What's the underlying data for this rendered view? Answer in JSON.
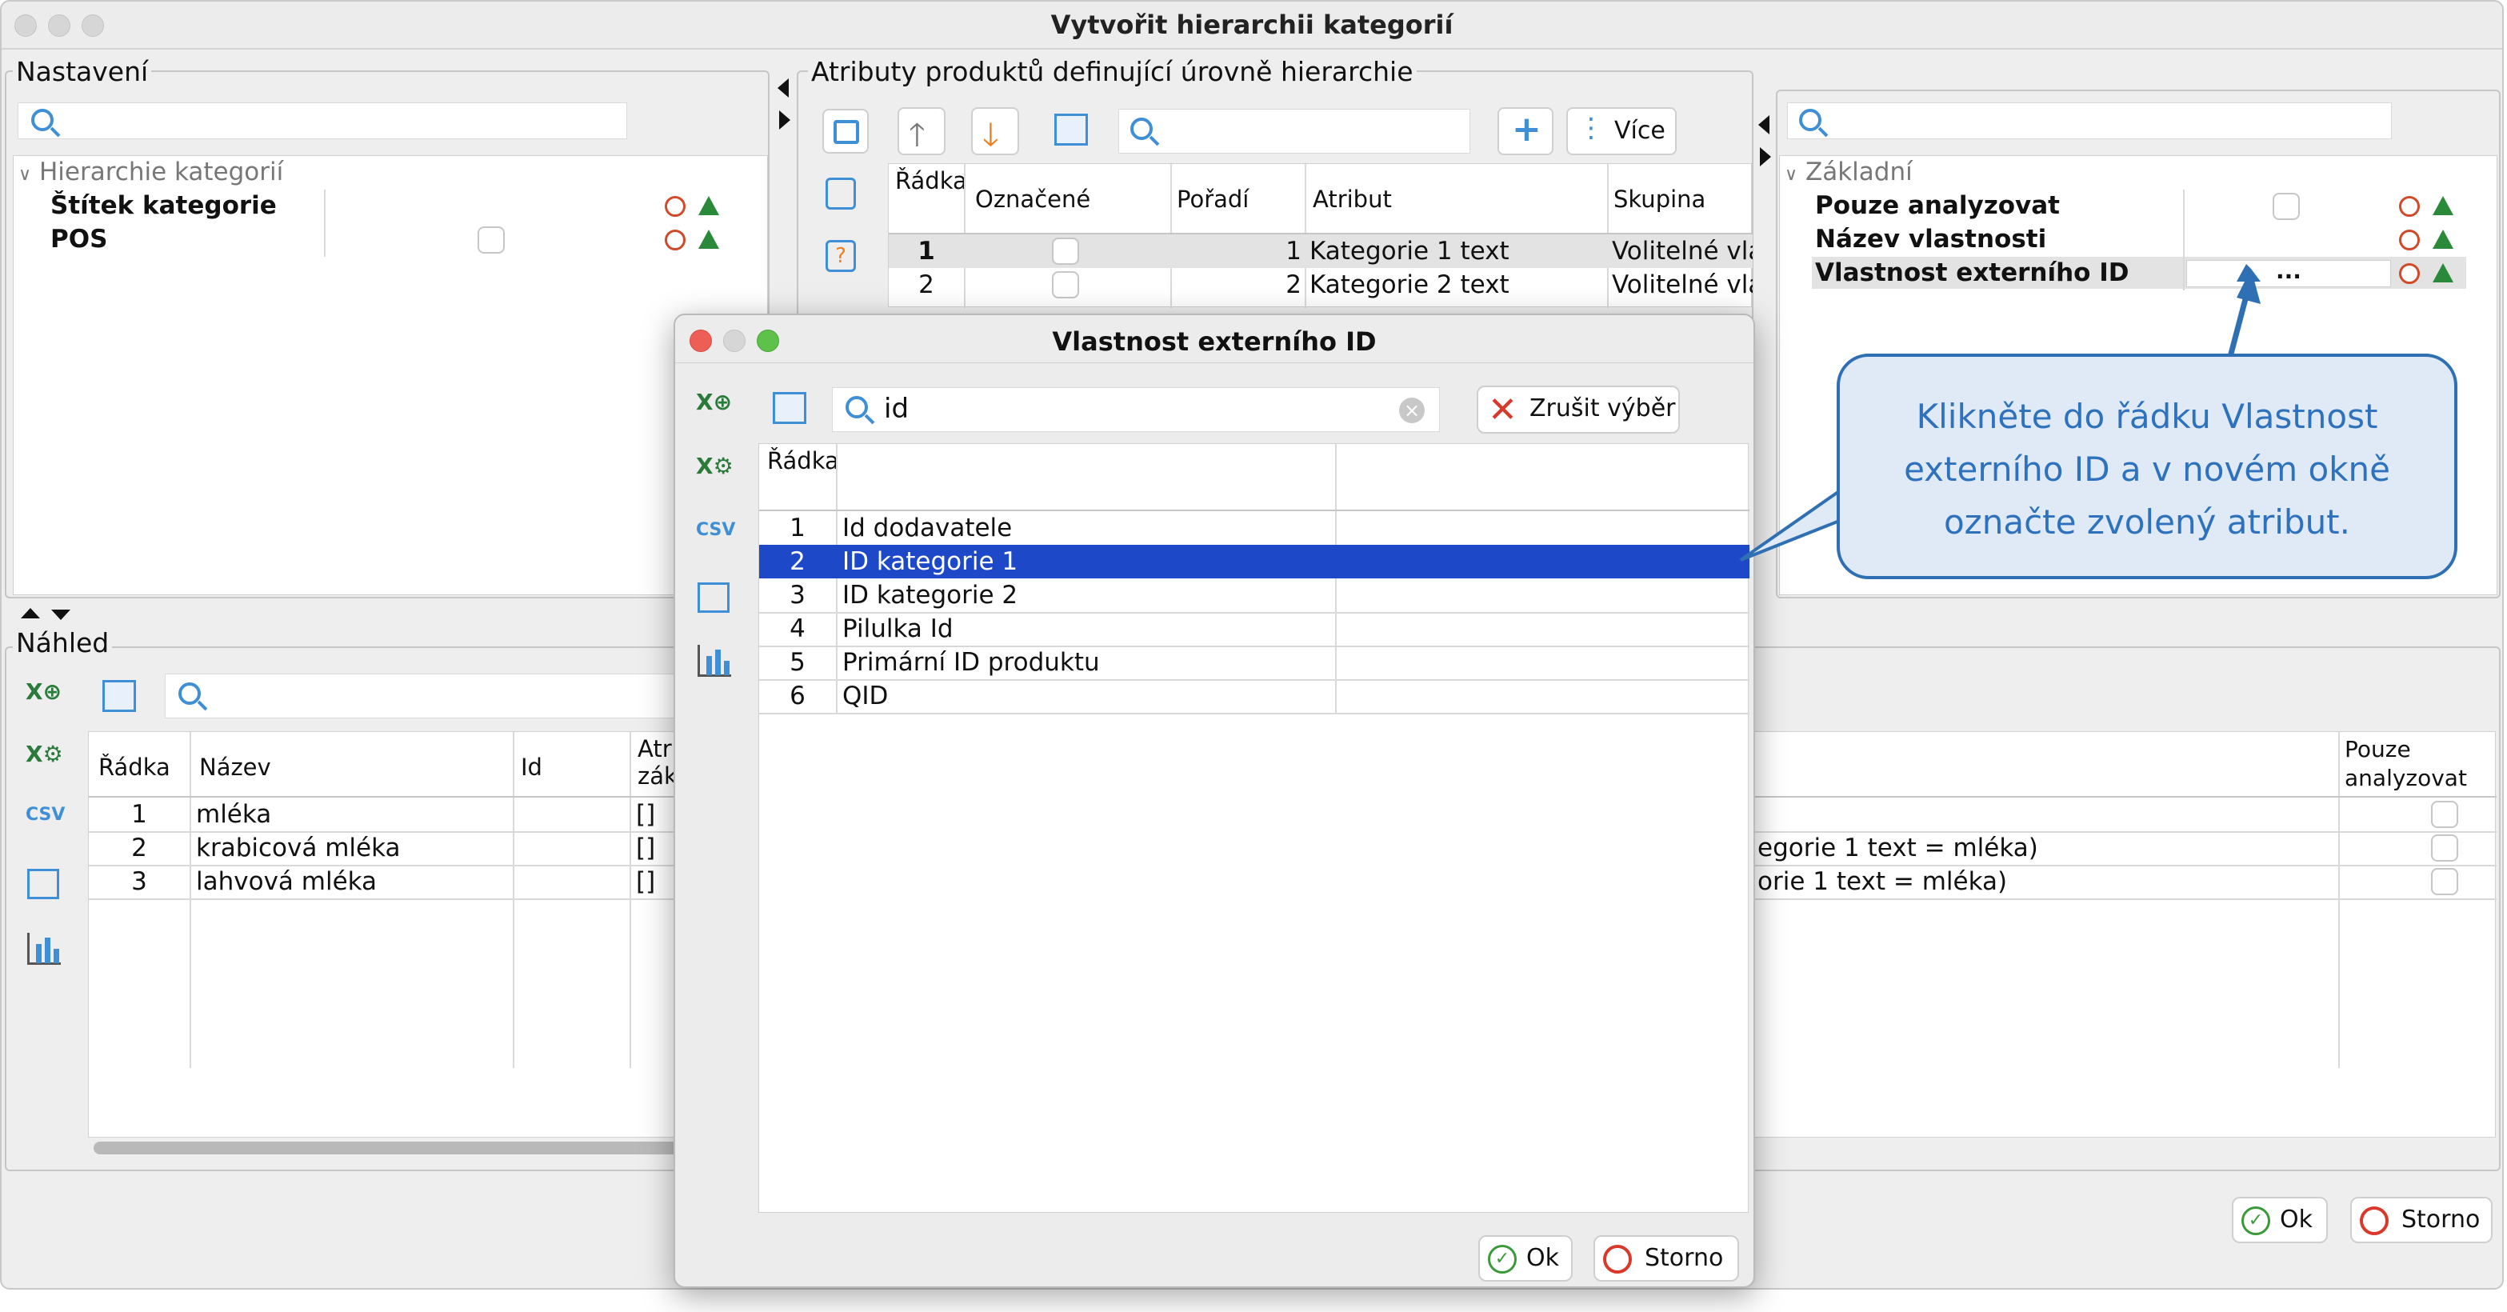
{
  "window": {
    "title": "Vytvořit hierarchii kategorií"
  },
  "settings": {
    "legend": "Nastavení",
    "section": "Hierarchie kategorií",
    "rows": [
      {
        "label": "Štítek kategorie"
      },
      {
        "label": "POS"
      }
    ]
  },
  "attrs": {
    "legend": "Atributy produktů definující úrovně hierarchie",
    "more_label": "Více",
    "columns": [
      "Řádka",
      "Označené",
      "Pořadí",
      "Atribut",
      "Skupina"
    ],
    "rows": [
      {
        "n": "1",
        "order": "1",
        "attr": "Kategorie 1 text",
        "group": "Volitelné vla"
      },
      {
        "n": "2",
        "order": "2",
        "attr": "Kategorie 2 text",
        "group": "Volitelné vla"
      }
    ]
  },
  "props": {
    "section": "Základní",
    "rows": [
      {
        "label": "Pouze analyzovat"
      },
      {
        "label": "Název vlastnosti"
      },
      {
        "label": "Vlastnost externího ID",
        "value": "..."
      }
    ]
  },
  "preview": {
    "legend": "Náhled",
    "columns": [
      "Řádka",
      "Název",
      "Id",
      "Atri zák"
    ],
    "right_col": "Pouze analyzovat",
    "rows": [
      {
        "n": "1",
        "name": "mléka",
        "attr": "[]",
        "right": ""
      },
      {
        "n": "2",
        "name": "krabicová mléka",
        "attr": "[]",
        "right": "egorie 1 text = mléka)"
      },
      {
        "n": "3",
        "name": "lahvová mléka",
        "attr": "[]",
        "right": "orie 1 text = mléka)"
      }
    ]
  },
  "footer": {
    "ok_label": "Ok",
    "cancel_label": "Storno"
  },
  "dialog": {
    "title": "Vlastnost externího ID",
    "search_value": "id",
    "clear_label": "Zrušit výběr",
    "column": "Řádka",
    "items": [
      {
        "n": "1",
        "label": "Id dodavatele"
      },
      {
        "n": "2",
        "label": "ID kategorie 1"
      },
      {
        "n": "3",
        "label": "ID kategorie 2"
      },
      {
        "n": "4",
        "label": "Pilulka Id"
      },
      {
        "n": "5",
        "label": "Primární ID produktu"
      },
      {
        "n": "6",
        "label": "QID"
      }
    ],
    "ok_label": "Ok",
    "cancel_label": "Storno"
  },
  "callout": {
    "text": "Klikněte do řádku Vlastnost externího ID a v novém okně označte zvolený atribut."
  },
  "colors": {
    "selection": "#1d49c8",
    "callout_border": "#2f6fb3",
    "callout_text": "#2e72bd",
    "arrow_orange": "#f07d1e"
  }
}
